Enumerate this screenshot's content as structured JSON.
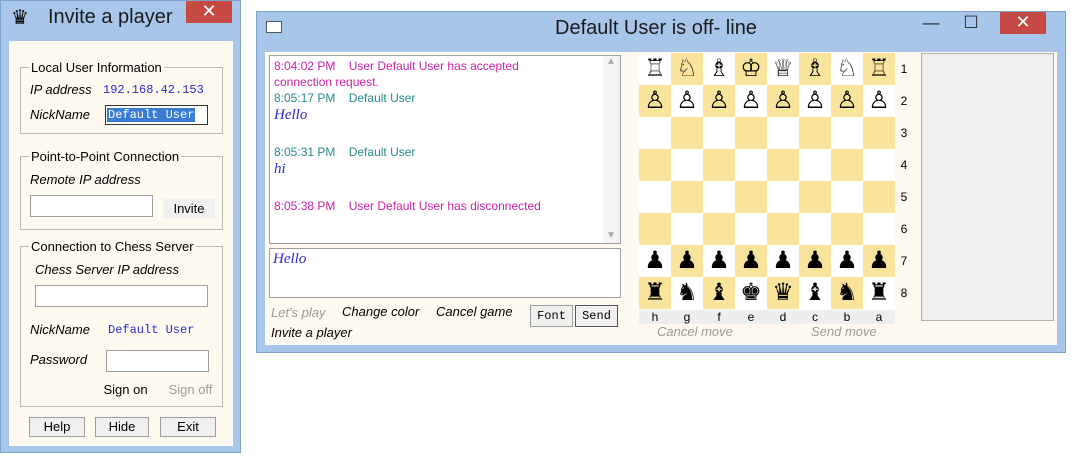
{
  "invite_window": {
    "title": "Invite a player",
    "close_glyph": "✕",
    "local_user": {
      "legend": "Local User Information",
      "ip_label": "IP address",
      "ip_value": "192.168.42.153",
      "nick_label": "NickName",
      "nick_value": "Default User"
    },
    "p2p": {
      "legend": "Point-to-Point Connection",
      "remote_ip_label": "Remote IP address",
      "remote_ip_value": "",
      "invite_label": "Invite"
    },
    "server": {
      "legend": "Connection to Chess Server",
      "server_ip_label": "Chess Server IP address",
      "server_ip_value": "",
      "nick_label": "NickName",
      "nick_value": "Default User",
      "password_label": "Password",
      "password_value": "",
      "sign_on_label": "Sign on",
      "sign_off_label": "Sign off"
    },
    "buttons": {
      "help": "Help",
      "hide": "Hide",
      "exit": "Exit"
    }
  },
  "game_window": {
    "title": "Default User is off- line",
    "controls": {
      "minimize": "—",
      "maximize": "☐",
      "close": "✕"
    },
    "chat_messages": [
      {
        "time": "8:04:02 PM",
        "text": "User Default User has accepted",
        "continuation": "connection request."
      },
      {
        "time": "8:05:17 PM",
        "sender": "Default User",
        "body": "Hello"
      },
      {
        "time": "8:05:31 PM",
        "sender": "Default User",
        "body": "hi"
      },
      {
        "time": "8:05:38 PM",
        "text": "User Default User has disconnected"
      }
    ],
    "compose_text": "Hello",
    "links": {
      "lets_play": "Let's play",
      "change_color": "Change color",
      "cancel_game": "Cancel game",
      "invite_player": "Invite a player"
    },
    "font_button": "Font",
    "send_button": "Send",
    "board": {
      "files": [
        "h",
        "g",
        "f",
        "e",
        "d",
        "c",
        "b",
        "a"
      ],
      "ranks": [
        "1",
        "2",
        "3",
        "4",
        "5",
        "6",
        "7",
        "8"
      ],
      "rank1": [
        "♖",
        "♘",
        "♗",
        "♔",
        "♕",
        "♗",
        "♘",
        "♖"
      ],
      "rank2": [
        "♙",
        "♙",
        "♙",
        "♙",
        "♙",
        "♙",
        "♙",
        "♙"
      ],
      "rank7": [
        "♟",
        "♟",
        "♟",
        "♟",
        "♟",
        "♟",
        "♟",
        "♟"
      ],
      "rank8": [
        "♜",
        "♞",
        "♝",
        "♚",
        "♛",
        "♝",
        "♞",
        "♜"
      ],
      "light_color": "#ffffff",
      "dark_color": "#fae39a"
    },
    "cancel_move": "Cancel move",
    "send_move": "Send move"
  },
  "colors": {
    "system_msg": "#cc22aa",
    "timestamp_teal": "#2a8a8a",
    "handwriting_blue": "#2a2ad0",
    "disabled_gray": "#9a9a9a"
  }
}
